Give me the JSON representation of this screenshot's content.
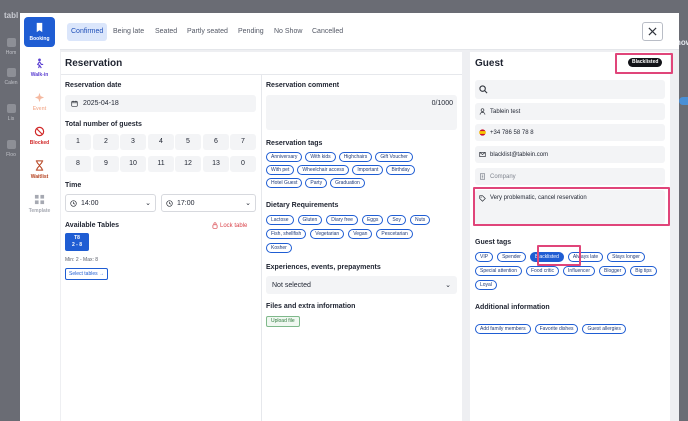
{
  "background": {
    "logo": "tabl",
    "items": [
      "Hom",
      "Calen",
      "Lis",
      "Floo"
    ],
    "right_label": "now"
  },
  "rail": [
    {
      "label": "Booking",
      "icon": "booking-icon"
    },
    {
      "label": "Walk-in",
      "icon": "walk-in-icon"
    },
    {
      "label": "Event",
      "icon": "event-icon"
    },
    {
      "label": "Blocked",
      "icon": "blocked-icon"
    },
    {
      "label": "Waitlist",
      "icon": "waitlist-icon"
    },
    {
      "label": "Template",
      "icon": "template-icon"
    }
  ],
  "tabs": [
    "Confirmed",
    "Being late",
    "Seated",
    "Partly seated",
    "Pending",
    "No Show",
    "Cancelled"
  ],
  "active_tab": "Confirmed",
  "reservation": {
    "title": "Reservation",
    "date_label": "Reservation date",
    "date_value": "2025-04-18",
    "guests_label": "Total number of guests",
    "guest_numbers": [
      "1",
      "2",
      "3",
      "4",
      "5",
      "6",
      "7",
      "8",
      "9",
      "10",
      "11",
      "12",
      "13",
      "0"
    ],
    "time_label": "Time",
    "time_start": "14:00",
    "time_end": "17:00",
    "tables_label": "Available Tables",
    "lock_label": "Lock table",
    "table_name": "T8",
    "table_capacity": "2 - 8",
    "minmax": "Min: 2 - Max: 8",
    "select_tables": "Select tables →"
  },
  "comment": {
    "label": "Reservation comment",
    "counter": "0/1000"
  },
  "reservation_tags": {
    "label": "Reservation tags",
    "items": [
      "Anniversary",
      "With kids",
      "Highchairs",
      "Gift Voucher",
      "With pet",
      "Wheelchair access",
      "Important",
      "Birthday",
      "Hotel Guest",
      "Party",
      "Graduation"
    ]
  },
  "dietary": {
    "label": "Dietary Requirements",
    "items": [
      "Lactose",
      "Gluten",
      "Diary free",
      "Eggs",
      "Soy",
      "Nuts",
      "Fish, shellfish",
      "Vegetarian",
      "Vegan",
      "Pescetarian",
      "Kosher"
    ]
  },
  "experiences": {
    "label": "Experiences, events, prepayments",
    "value": "Not selected"
  },
  "files": {
    "label": "Files and extra information",
    "upload": "Upload file"
  },
  "guest": {
    "title": "Guest",
    "badge": "Blacklisted",
    "name": "Tablein test",
    "phone": "+34 786 58 78 8",
    "email": "blacklist@tablein.com",
    "company_placeholder": "Company",
    "note": "Very problematic, cancel reservation",
    "tags_label": "Guest tags",
    "tags": [
      "VIP",
      "Spender",
      "Blacklisted",
      "Always late",
      "Stays longer",
      "Special attention",
      "Food critic",
      "Influencer",
      "Blogger",
      "Big tips",
      "Loyal"
    ],
    "selected_tag": "Blacklisted",
    "additional_label": "Additional information",
    "additional_buttons": [
      "Add family members",
      "Favorite dishes",
      "Guest allergies"
    ]
  },
  "colors": {
    "primary": "#1f5dd3",
    "highlight": "#e0457a",
    "danger": "#d9434a",
    "badge": "#121318"
  }
}
